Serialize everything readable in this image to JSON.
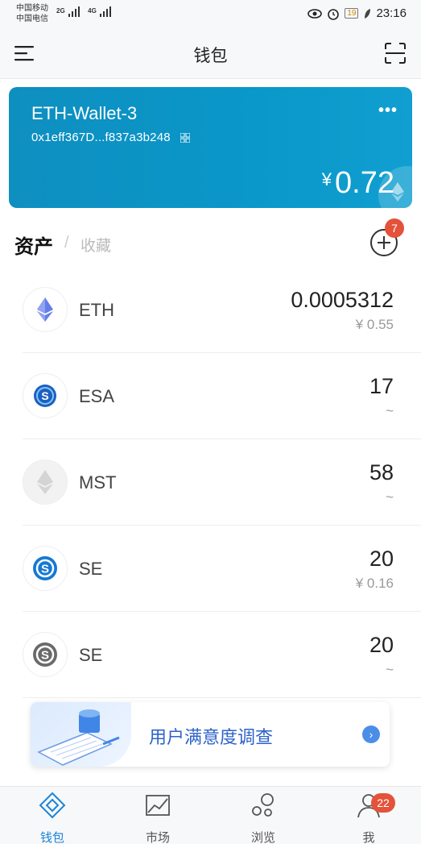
{
  "status_bar": {
    "carrier1": "中国移动",
    "carrier2": "中国电信",
    "net1": "2G",
    "net2": "4G",
    "battery": "19",
    "time": "23:16"
  },
  "header": {
    "title": "钱包"
  },
  "wallet": {
    "name": "ETH-Wallet-3",
    "address": "0x1eff367D...f837a3b248",
    "currency_symbol": "¥",
    "balance": "0.72"
  },
  "tabs": {
    "assets": "资产",
    "separator": "/",
    "favorites": "收藏",
    "add_badge": "7"
  },
  "assets": [
    {
      "symbol": "ETH",
      "amount": "0.0005312",
      "value": "¥ 0.55",
      "icon": "ethereum-icon"
    },
    {
      "symbol": "ESA",
      "amount": "17",
      "value": "~",
      "icon": "esa-token-icon"
    },
    {
      "symbol": "MST",
      "amount": "58",
      "value": "~",
      "icon": "mst-token-icon"
    },
    {
      "symbol": "SE",
      "amount": "20",
      "value": "¥ 0.16",
      "icon": "se-token-blue-icon"
    },
    {
      "symbol": "SE",
      "amount": "20",
      "value": "~",
      "icon": "se-token-gray-icon"
    }
  ],
  "banner": {
    "text": "用户满意度调查",
    "arrow": "›"
  },
  "bottom_nav": {
    "wallet": "钱包",
    "market": "市场",
    "browse": "浏览",
    "me": "我",
    "me_badge": "22"
  },
  "colors": {
    "card": "#0a97c9",
    "accent": "#1b84d8",
    "badge": "#e4523a",
    "banner_text": "#2e63c9"
  }
}
